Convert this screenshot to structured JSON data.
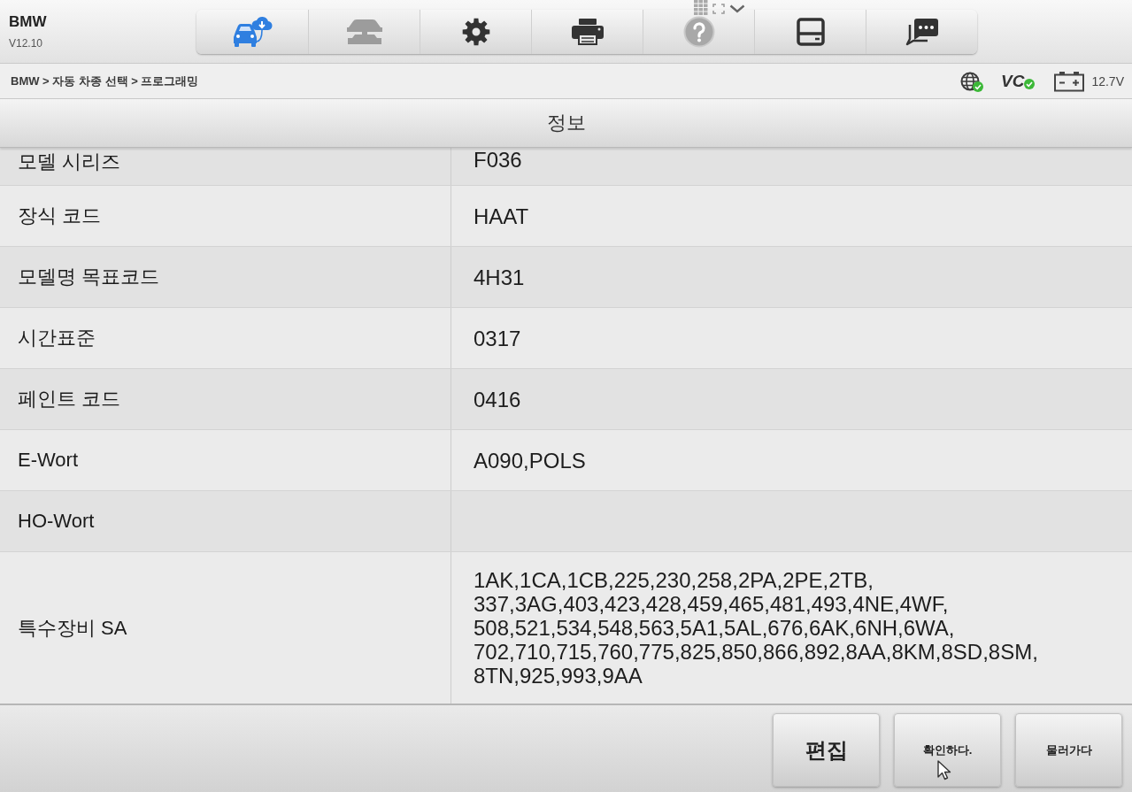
{
  "app": {
    "title": "BMW",
    "version": "V12.10"
  },
  "toolbar": {
    "buttons": [
      {
        "disabled": false
      },
      {
        "disabled": true
      },
      {
        "disabled": false
      },
      {
        "disabled": false
      },
      {
        "disabled": true
      },
      {
        "disabled": false
      },
      {
        "disabled": false
      }
    ]
  },
  "breadcrumb": "BMW > 자동 차종 선택 > 프로그래밍",
  "status": {
    "network_connected": true,
    "vci_label": "VC",
    "vci_connected": true,
    "battery_voltage": "12.7V"
  },
  "panel": {
    "title": "정보",
    "rows": [
      {
        "label": "모델 시리즈",
        "value": "F036"
      },
      {
        "label": "장식 코드",
        "value": "HAAT"
      },
      {
        "label": "모델명 목표코드",
        "value": "4H31"
      },
      {
        "label": "시간표준",
        "value": "0317"
      },
      {
        "label": "페인트 코드",
        "value": "0416"
      },
      {
        "label": "E-Wort",
        "value": "A090,POLS"
      },
      {
        "label": "HO-Wort"
      },
      {
        "label": "특수장비 SA",
        "value": "1AK,1CA,1CB,225,230,258,2PA,2PE,2TB,\n337,3AG,403,423,428,459,465,481,493,4NE,4WF,\n508,521,534,548,563,5A1,5AL,676,6AK,6NH,6WA,\n702,710,715,760,775,825,850,866,892,8AA,8KM,8SD,8SM,\n8TN,925,993,9AA"
      }
    ]
  },
  "actions": [
    {
      "label": "편집",
      "kind": "primary"
    },
    {
      "label": "확인하다.",
      "kind": "normal"
    },
    {
      "label": "물러가다",
      "kind": "normal"
    }
  ]
}
